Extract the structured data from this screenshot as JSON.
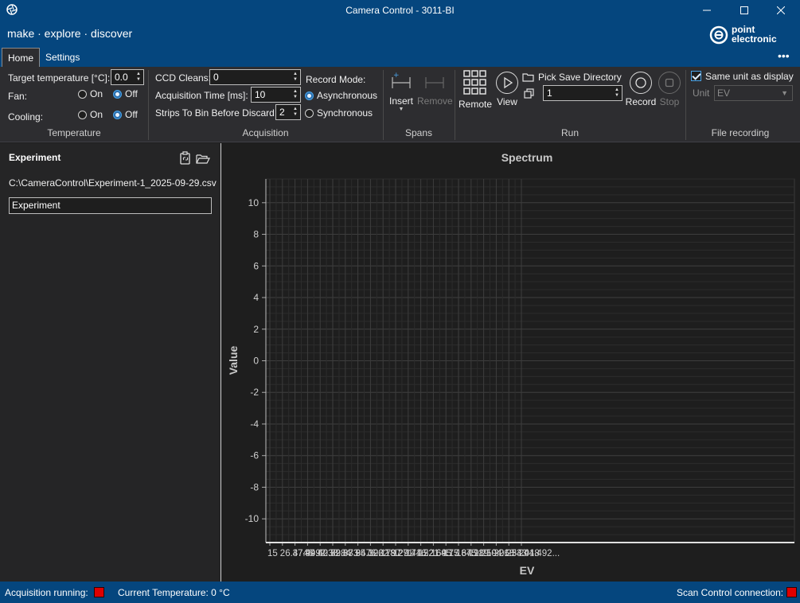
{
  "window": {
    "title": "Camera Control - 3011-BI",
    "slogan": "make · explore · discover",
    "logo_line1": "point",
    "logo_line2": "electronic"
  },
  "tabs": [
    {
      "label": "Home",
      "selected": true
    },
    {
      "label": "Settings",
      "selected": false
    }
  ],
  "more_glyph": "•••",
  "ribbon": {
    "temperature": {
      "group_label": "Temperature",
      "target_label": "Target temperature [°C]:",
      "target_value": "0.0",
      "fan_label": "Fan:",
      "fan_on": "On",
      "fan_off": "Off",
      "fan_selected": "Off",
      "cooling_label": "Cooling:",
      "cooling_on": "On",
      "cooling_off": "Off",
      "cooling_selected": "Off"
    },
    "acquisition": {
      "group_label": "Acquisition",
      "ccd_cleans_label": "CCD Cleans:",
      "ccd_cleans_value": "0",
      "acq_time_label": "Acquisition Time [ms]:",
      "acq_time_value": "10",
      "strips_label": "Strips To Bin Before Discard:",
      "strips_value": "2",
      "record_mode_label": "Record Mode:",
      "async_label": "Asynchronous",
      "sync_label": "Synchronous",
      "record_mode_selected": "Asynchronous"
    },
    "spans": {
      "group_label": "Spans",
      "insert_label": "Insert",
      "remove_label": "Remove"
    },
    "run": {
      "group_label": "Run",
      "remote_label": "Remote",
      "view_label": "View",
      "pick_dir_label": "Pick Save Directory",
      "count_value": "1",
      "record_label": "Record",
      "stop_label": "Stop"
    },
    "file_recording": {
      "group_label": "File recording",
      "same_unit_label": "Same unit as display",
      "same_unit_checked": true,
      "unit_label": "Unit",
      "unit_value": "EV"
    }
  },
  "experiment": {
    "title": "Experiment",
    "path": "C:\\CameraControl\\Experiment-1_2025-09-29.csv",
    "name_value": "Experiment"
  },
  "chart_data": {
    "type": "line",
    "title": "Spectrum",
    "xlabel": "EV",
    "ylabel": "Value",
    "ylim": [
      -11.5,
      11.5
    ],
    "y_ticks": [
      10,
      8,
      6,
      4,
      2,
      0,
      -2,
      -4,
      -6,
      -8,
      -10
    ],
    "x_tick_labels": [
      "15",
      "26.4746",
      "37.9492",
      "49.4238",
      "60.8984",
      "72.373",
      "83.8476",
      "95.3222",
      "106.797",
      "118.271",
      "129.746",
      "141.221",
      "152.695",
      "164.17",
      "175.645",
      "187.119",
      "198.594",
      "210.068",
      "221.543",
      "233.018",
      "244.492..."
    ],
    "series": [],
    "grid": true
  },
  "status": {
    "acq_running_label": "Acquisition running:",
    "current_temp_label": "Current Temperature: 0 °C",
    "scan_control_label": "Scan Control connection:",
    "led_color": "#e00000"
  },
  "colors": {
    "brand_blue": "#05467e",
    "ribbon_bg": "#2d2d30",
    "accent": "#4aa3e8"
  }
}
